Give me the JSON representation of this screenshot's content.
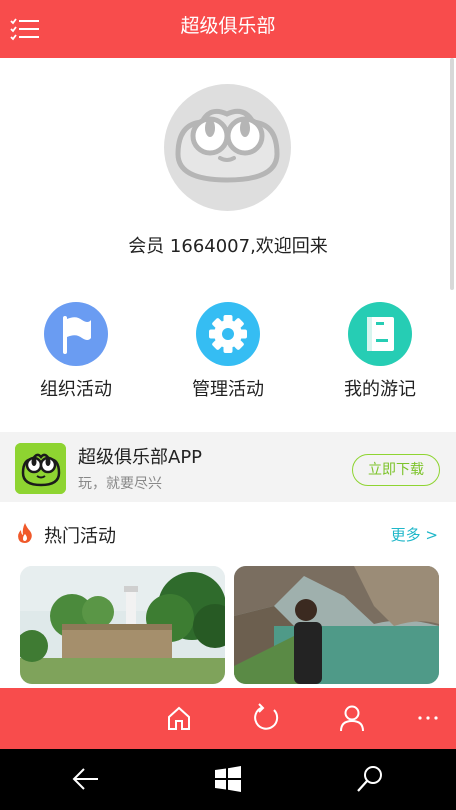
{
  "header": {
    "title": "超级俱乐部",
    "menu_icon": "menu-checklist-icon"
  },
  "profile": {
    "welcome": "会员 1664007,欢迎回来",
    "avatar_icon": "frog-avatar-icon"
  },
  "actions": [
    {
      "label": "组织活动",
      "icon": "flag-icon",
      "color": "#6a9cf2"
    },
    {
      "label": "管理活动",
      "icon": "gear-icon",
      "color": "#35bdf3"
    },
    {
      "label": "我的游记",
      "icon": "notebook-icon",
      "color": "#26cdb4"
    }
  ],
  "app_promo": {
    "name": "超级俱乐部APP",
    "slogan": "玩，就要尽兴",
    "download": "立即下载",
    "logo_color": "#8ed431"
  },
  "hot": {
    "title": "热门活动",
    "more": "更多 >"
  },
  "tabbar": {
    "icons": [
      "home-icon",
      "refresh-icon",
      "person-icon",
      "more-icon"
    ],
    "color": "#f84c4c"
  },
  "system_keys": [
    "back-icon",
    "windows-icon",
    "search-icon"
  ]
}
